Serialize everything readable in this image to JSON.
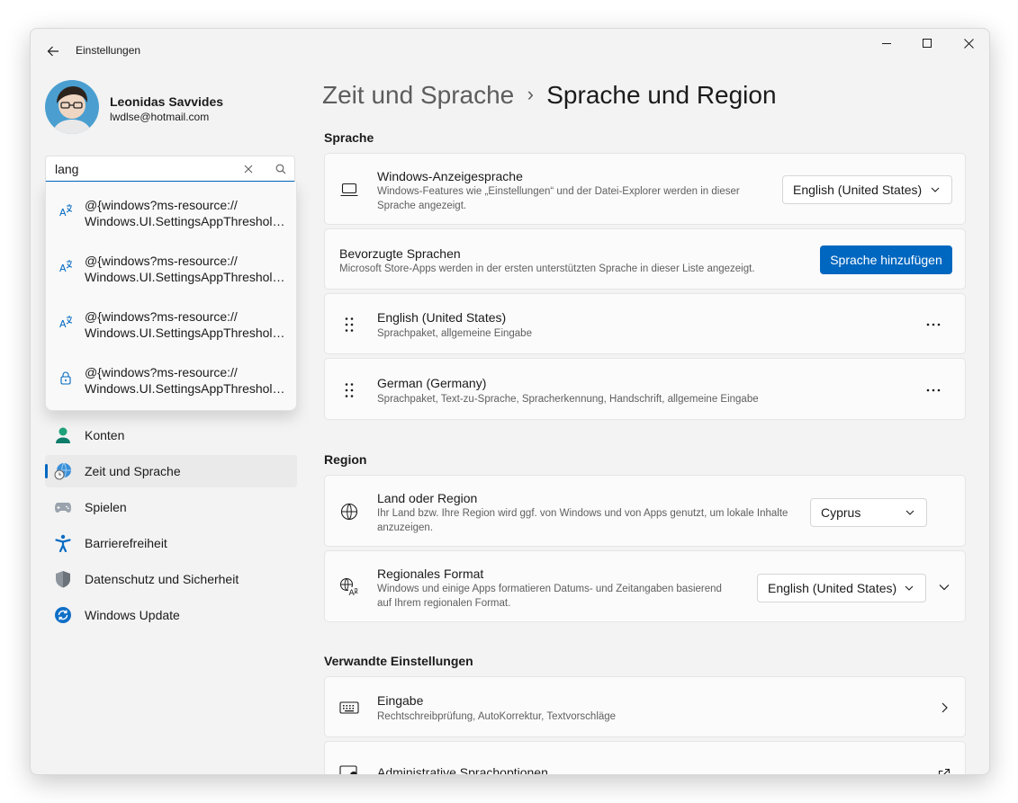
{
  "app": {
    "title": "Einstellungen"
  },
  "user": {
    "name": "Leonidas Savvides",
    "email": "lwdlse@hotmail.com"
  },
  "search": {
    "value": "lang",
    "placeholder": ""
  },
  "suggestions": [
    {
      "line1": "@{windows?ms-resource://",
      "line2": "Windows.UI.SettingsAppThreshold/SearchResources/Language",
      "icon": "language-icon"
    },
    {
      "line1": "@{windows?ms-resource://",
      "line2": "Windows.UI.SettingsAppThreshold/SearchResources/Language",
      "icon": "language-icon"
    },
    {
      "line1": "@{windows?ms-resource://",
      "line2": "Windows.UI.SettingsAppThreshold/SearchResources/Language",
      "icon": "language-icon"
    },
    {
      "line1": "@{windows?ms-resource://",
      "line2": "Windows.UI.SettingsAppThreshold/SearchResources/Privacy",
      "icon": "lock-icon"
    }
  ],
  "nav": [
    {
      "label": "Konten",
      "icon": "accounts-icon",
      "selected": false
    },
    {
      "label": "Zeit und Sprache",
      "icon": "time-language-icon",
      "selected": true
    },
    {
      "label": "Spielen",
      "icon": "gaming-icon",
      "selected": false
    },
    {
      "label": "Barrierefreiheit",
      "icon": "accessibility-icon",
      "selected": false
    },
    {
      "label": "Datenschutz und Sicherheit",
      "icon": "shield-icon",
      "selected": false
    },
    {
      "label": "Windows Update",
      "icon": "update-icon",
      "selected": false
    }
  ],
  "breadcrumb": {
    "parent": "Zeit und Sprache",
    "separator": "›",
    "current": "Sprache und Region"
  },
  "sections": {
    "sprache": "Sprache",
    "region": "Region",
    "related": "Verwandte Einstellungen"
  },
  "display_language": {
    "title": "Windows-Anzeigesprache",
    "desc": "Windows-Features wie „Einstellungen“ und der Datei-Explorer werden in dieser Sprache angezeigt.",
    "value": "English (United States)"
  },
  "preferred": {
    "title": "Bevorzugte Sprachen",
    "desc": "Microsoft Store-Apps werden in der ersten unterstützten Sprache in dieser Liste angezeigt.",
    "button": "Sprache hinzufügen"
  },
  "languages": [
    {
      "name": "English (United States)",
      "desc": "Sprachpaket, allgemeine Eingabe"
    },
    {
      "name": "German (Germany)",
      "desc": "Sprachpaket, Text-zu-Sprache, Spracherkennung, Handschrift, allgemeine Eingabe"
    }
  ],
  "country": {
    "title": "Land oder Region",
    "desc": "Ihr Land bzw. Ihre Region wird ggf. von Windows und von Apps genutzt, um lokale Inhalte anzuzeigen.",
    "value": "Cyprus"
  },
  "regional_format": {
    "title": "Regionales Format",
    "desc": "Windows und einige Apps formatieren Datums- und Zeitangaben basierend auf Ihrem regionalen Format.",
    "value": "English (United States)"
  },
  "typing": {
    "title": "Eingabe",
    "desc": "Rechtschreibprüfung, AutoKorrektur, Textvorschläge"
  },
  "admin_lang": {
    "title": "Administrative Sprachoptionen"
  },
  "colors": {
    "accent": "#0067c0",
    "window_bg": "#f3f3f3",
    "card_bg": "#fbfbfb"
  }
}
